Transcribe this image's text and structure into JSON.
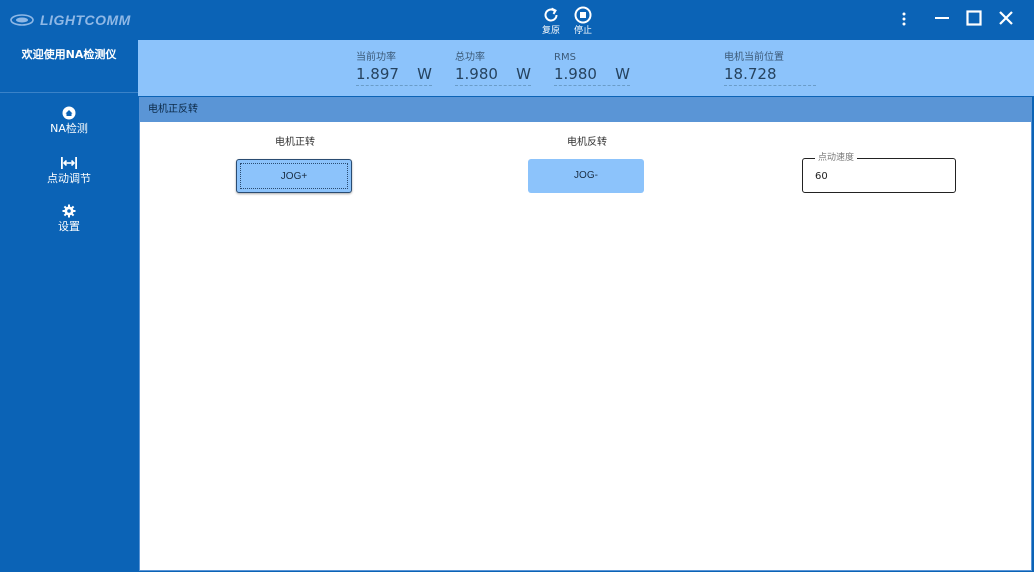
{
  "app": {
    "logo_text": "LIGHTCOMM",
    "welcome": "欢迎使用NA检测仪"
  },
  "toolbar": {
    "reset_label": "复原",
    "stop_label": "停止"
  },
  "window_controls": {
    "more_icon": "more-vertical-icon",
    "minimize_icon": "minimize-icon",
    "maximize_icon": "maximize-icon",
    "close_icon": "close-icon"
  },
  "sidebar": {
    "items": [
      {
        "label": "NA检测",
        "icon": "home-icon"
      },
      {
        "label": "点动调节",
        "icon": "arrows-horizontal-icon"
      },
      {
        "label": "设置",
        "icon": "gear-icon"
      }
    ]
  },
  "stats": [
    {
      "label": "当前功率",
      "value": "1.897",
      "unit": "W"
    },
    {
      "label": "总功率",
      "value": "1.980",
      "unit": "W"
    },
    {
      "label": "RMS",
      "value": "1.980",
      "unit": "W"
    },
    {
      "label": "电机当前位置",
      "value": "18.728",
      "unit": ""
    }
  ],
  "panel": {
    "title": "电机正反转",
    "forward_title": "电机正转",
    "reverse_title": "电机反转",
    "jog_plus_label": "JOG+",
    "jog_minus_label": "JOG-",
    "speed_label": "点动速度",
    "speed_value": "60"
  },
  "colors": {
    "primary": "#0b63b6",
    "stats_bg": "#8cc3fb",
    "panel_header": "#5a95d6",
    "button_bg": "#8cc3fb"
  }
}
